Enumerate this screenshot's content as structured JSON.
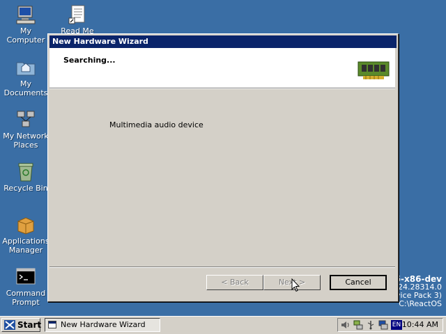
{
  "desktop": {
    "icons": [
      {
        "label": "My Computer"
      },
      {
        "label": "Read Me"
      },
      {
        "label": "My Documents"
      },
      {
        "label": "My Network Places"
      },
      {
        "label": "Recycle Bin"
      },
      {
        "label": "Applications Manager"
      },
      {
        "label": "Command Prompt"
      }
    ],
    "watermark": {
      "line1": "15-x86-dev",
      "line2": "19.24.28314.0",
      "line3": "ervice Pack 3)",
      "line4": "C:\\ReactOS"
    }
  },
  "wizard": {
    "title": "New Hardware Wizard",
    "headline": "Searching...",
    "header_icon": "hardware-card-icon",
    "device": "Multimedia audio device",
    "buttons": {
      "back": "< Back",
      "next": "Next >",
      "cancel": "Cancel"
    }
  },
  "taskbar": {
    "start": "Start",
    "task": "New Hardware Wizard",
    "tray": {
      "icons": [
        "volume-icon",
        "network-icon",
        "usb-icon",
        "display-icon"
      ],
      "language": "EN",
      "clock": "10:44 AM"
    }
  },
  "colors": {
    "desktop": "#3a6ea5",
    "titlebar": "#0a246a",
    "face": "#d4d0c8"
  }
}
